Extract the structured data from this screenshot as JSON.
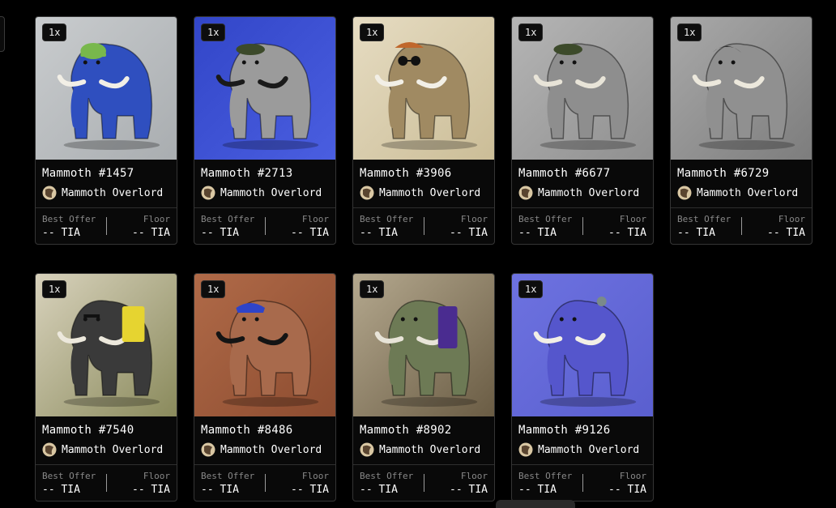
{
  "cards": [
    {
      "qty": "1x",
      "title": "Mammoth #1457",
      "collection": "Mammoth Overlord",
      "best_offer_label": "Best Offer",
      "best_offer": "-- TIA",
      "floor_label": "Floor",
      "floor": "-- TIA",
      "art": {
        "bg": "#c9ccce",
        "bg2": "#a9adb0",
        "body": "#2f4fbf",
        "tusk": "#f2efe6",
        "hat": "#78b84c",
        "accessory": "cap"
      }
    },
    {
      "qty": "1x",
      "title": "Mammoth #2713",
      "collection": "Mammoth Overlord",
      "best_offer_label": "Best Offer",
      "best_offer": "-- TIA",
      "floor_label": "Floor",
      "floor": "-- TIA",
      "art": {
        "bg": "#3246c8",
        "bg2": "#4a5ee0",
        "body": "#9b9b9b",
        "tusk": "#1a1a1a",
        "hat": "#3c4a2a",
        "accessory": "beret"
      }
    },
    {
      "qty": "1x",
      "title": "Mammoth #3906",
      "collection": "Mammoth Overlord",
      "best_offer_label": "Best Offer",
      "best_offer": "-- TIA",
      "floor_label": "Floor",
      "floor": "-- TIA",
      "art": {
        "bg": "#e6dcc2",
        "bg2": "#cbbd97",
        "body": "#a08a62",
        "tusk": "#f2efe6",
        "hat": "#c0672c",
        "accessory": "glasses"
      }
    },
    {
      "qty": "1x",
      "title": "Mammoth #6677",
      "collection": "Mammoth Overlord",
      "best_offer_label": "Best Offer",
      "best_offer": "-- TIA",
      "floor_label": "Floor",
      "floor": "-- TIA",
      "art": {
        "bg": "#b5b5b5",
        "bg2": "#8f8f8f",
        "body": "#8e8e8e",
        "tusk": "#e8e4d8",
        "hat": "#3c4a2a",
        "accessory": "beret"
      }
    },
    {
      "qty": "1x",
      "title": "Mammoth #6729",
      "collection": "Mammoth Overlord",
      "best_offer_label": "Best Offer",
      "best_offer": "-- TIA",
      "floor_label": "Floor",
      "floor": "-- TIA",
      "art": {
        "bg": "#a9a9a9",
        "bg2": "#7d7d7d",
        "body": "#909090",
        "tusk": "#ece8dc",
        "hat": "#2a2a2a",
        "accessory": "hair"
      }
    },
    {
      "qty": "1x",
      "title": "Mammoth #7540",
      "collection": "Mammoth Overlord",
      "best_offer_label": "Best Offer",
      "best_offer": "-- TIA",
      "floor_label": "Floor",
      "floor": "-- TIA",
      "art": {
        "bg": "#d8d2bc",
        "bg2": "#8a8a5c",
        "body": "#3a3a3a",
        "tusk": "#ece8dc",
        "hat": "#e6d430",
        "accessory": "flag"
      }
    },
    {
      "qty": "1x",
      "title": "Mammoth #8486",
      "collection": "Mammoth Overlord",
      "best_offer_label": "Best Offer",
      "best_offer": "-- TIA",
      "floor_label": "Floor",
      "floor": "-- TIA",
      "art": {
        "bg": "#b06a48",
        "bg2": "#8c4c30",
        "body": "#a86a4c",
        "tusk": "#141414",
        "hat": "#2f44c8",
        "accessory": "bandana"
      }
    },
    {
      "qty": "1x",
      "title": "Mammoth #8902",
      "collection": "Mammoth Overlord",
      "best_offer_label": "Best Offer",
      "best_offer": "-- TIA",
      "floor_label": "Floor",
      "floor": "-- TIA",
      "art": {
        "bg": "#b4a88e",
        "bg2": "#6a5c44",
        "body": "#6d7a55",
        "tusk": "#e8e4d8",
        "hat": "#4a2c90",
        "accessory": "camo"
      }
    },
    {
      "qty": "1x",
      "title": "Mammoth #9126",
      "collection": "Mammoth Overlord",
      "best_offer_label": "Best Offer",
      "best_offer": "-- TIA",
      "floor_label": "Floor",
      "floor": "-- TIA",
      "art": {
        "bg": "#6d72e0",
        "bg2": "#5a5fcf",
        "body": "#5556cc",
        "tusk": "#f2efe6",
        "hat": "#7a8a8a",
        "accessory": "bird"
      }
    }
  ]
}
